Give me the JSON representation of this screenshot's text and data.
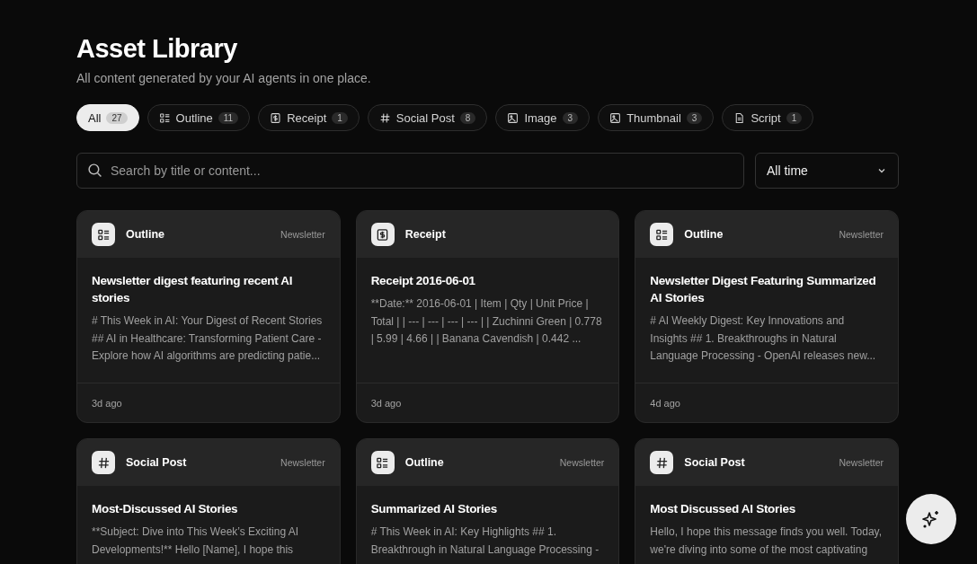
{
  "header": {
    "title": "Asset Library",
    "subtitle": "All content generated by your AI agents in one place."
  },
  "filters": [
    {
      "kind": "all",
      "label": "All",
      "count": "27",
      "selected": true
    },
    {
      "kind": "outline",
      "label": "Outline",
      "count": "11",
      "selected": false
    },
    {
      "kind": "receipt",
      "label": "Receipt",
      "count": "1",
      "selected": false
    },
    {
      "kind": "social",
      "label": "Social Post",
      "count": "8",
      "selected": false
    },
    {
      "kind": "image",
      "label": "Image",
      "count": "3",
      "selected": false
    },
    {
      "kind": "image",
      "label": "Thumbnail",
      "count": "3",
      "selected": false
    },
    {
      "kind": "script",
      "label": "Script",
      "count": "1",
      "selected": false
    }
  ],
  "search": {
    "placeholder": "Search by title or content..."
  },
  "time_filter": {
    "value": "All time"
  },
  "cards": [
    {
      "kind": "outline",
      "type": "Outline",
      "source": "Newsletter",
      "title": "Newsletter digest featuring recent AI stories",
      "excerpt": "# This Week in AI: Your Digest of Recent Stories ## AI in Healthcare: Transforming Patient Care - Explore how AI algorithms are predicting patie...",
      "age": "3d ago"
    },
    {
      "kind": "receipt",
      "type": "Receipt",
      "title": "Receipt 2016-06-01",
      "excerpt": "**Date:** 2016-06-01 | Item | Qty | Unit Price | Total | | --- | --- | --- | --- | | Zuchinni Green | 0.778 | 5.99 | 4.66 | | Banana Cavendish | 0.442 ...",
      "age": "3d ago"
    },
    {
      "kind": "outline",
      "type": "Outline",
      "source": "Newsletter",
      "title": "Newsletter Digest Featuring Summarized AI Stories",
      "excerpt": "# AI Weekly Digest: Key Innovations and Insights ## 1. Breakthroughs in Natural Language Processing - OpenAI releases new...",
      "age": "4d ago"
    },
    {
      "kind": "social",
      "type": "Social Post",
      "source": "Newsletter",
      "title": "Most-Discussed AI Stories",
      "excerpt": "**Subject: Dive into This Week’s Exciting AI Developments!** Hello [Name], I hope this"
    },
    {
      "kind": "outline",
      "type": "Outline",
      "source": "Newsletter",
      "title": "Summarized AI Stories",
      "excerpt": "# This Week in AI: Key Highlights ## 1. Breakthrough in Natural Language Processing -"
    },
    {
      "kind": "social",
      "type": "Social Post",
      "source": "Newsletter",
      "title": "Most Discussed AI Stories",
      "excerpt": "Hello, I hope this message finds you well. Today, we're diving into some of the most captivating"
    }
  ]
}
